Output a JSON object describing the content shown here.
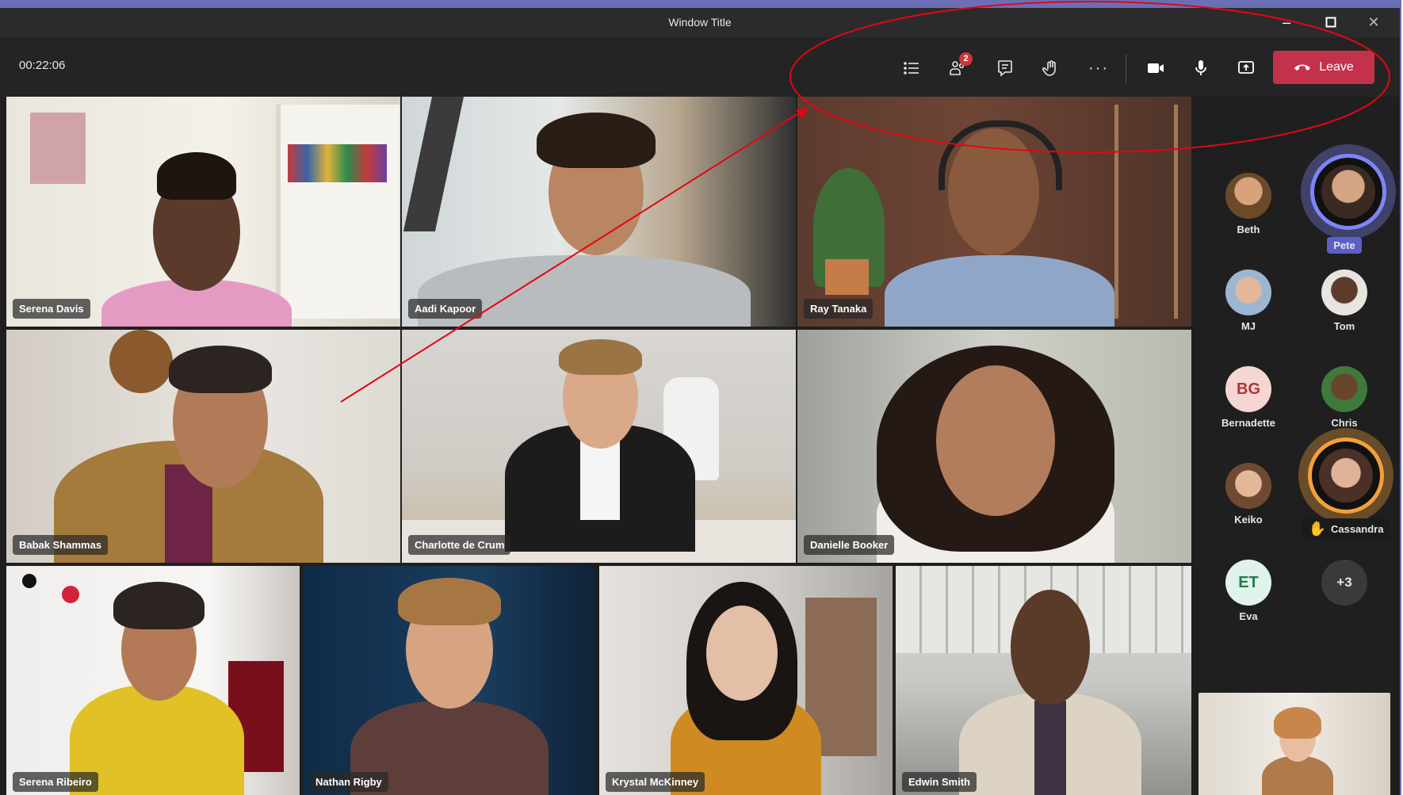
{
  "window": {
    "title": "Window Title"
  },
  "toolbar": {
    "timer": "00:22:06",
    "people_badge": "2",
    "leave_label": "Leave"
  },
  "tiles": [
    {
      "name": "Serena Davis"
    },
    {
      "name": "Aadi Kapoor"
    },
    {
      "name": "Ray Tanaka"
    },
    {
      "name": "Babak Shammas"
    },
    {
      "name": "Charlotte de Crum"
    },
    {
      "name": "Danielle Booker"
    },
    {
      "name": "Serena Ribeiro"
    },
    {
      "name": "Nathan Rigby"
    },
    {
      "name": "Krystal McKinney"
    },
    {
      "name": "Edwin Smith"
    }
  ],
  "participants": [
    {
      "name": "Beth"
    },
    {
      "name": "Pete"
    },
    {
      "name": "MJ"
    },
    {
      "name": "Tom"
    },
    {
      "name": "Bernadette",
      "initials": "BG"
    },
    {
      "name": "Chris"
    },
    {
      "name": "Keiko"
    },
    {
      "name": "Cassandra"
    },
    {
      "name": "Eva",
      "initials": "ET"
    },
    {
      "more": "+3"
    }
  ],
  "colors": {
    "accent_border": "#6b6fb6",
    "leave_red": "#c4314b",
    "badge_red": "#d13438",
    "speaking_ring": "#7f85f5",
    "hand_raised_ring": "#f3a03a",
    "annotation_red": "#e30613"
  }
}
